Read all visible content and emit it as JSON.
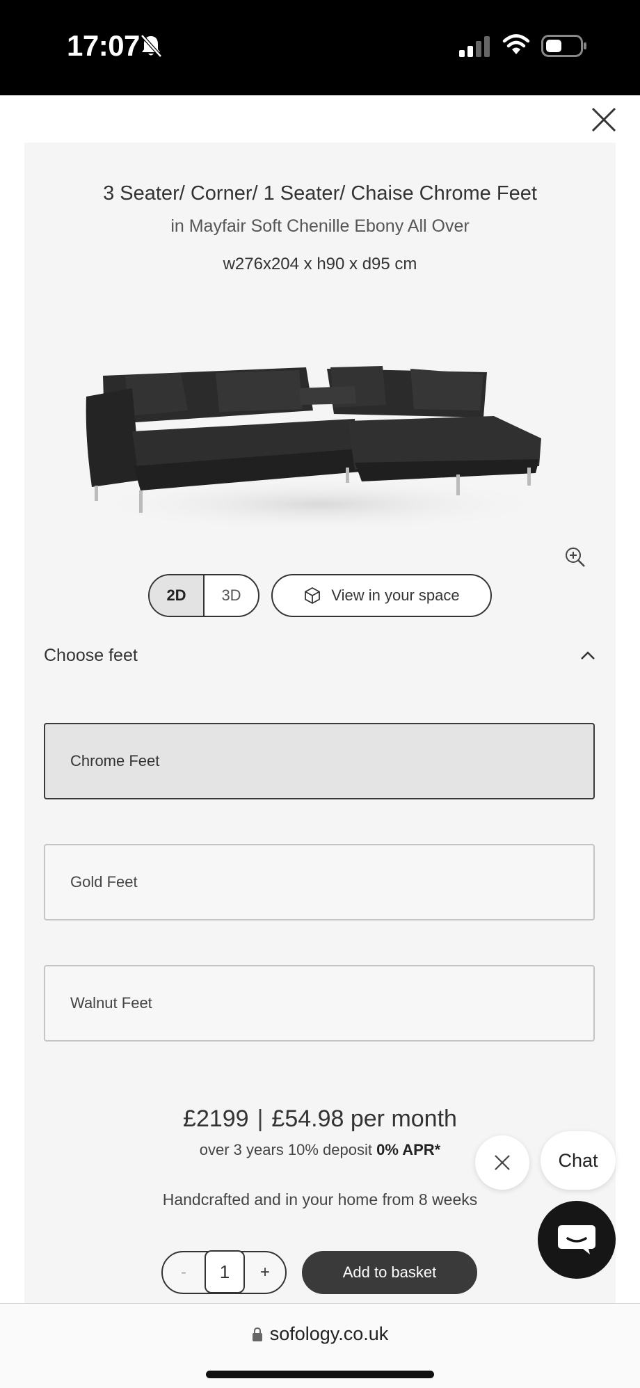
{
  "status_bar": {
    "time": "17:07"
  },
  "product": {
    "title": "3 Seater/ Corner/ 1 Seater/ Chaise Chrome Feet",
    "fabric": "in Mayfair Soft Chenille Ebony All Over",
    "dimensions": "w276x204 x h90 x d95 cm"
  },
  "view_toggle": {
    "option_2d": "2D",
    "option_3d": "3D",
    "selected": "2D"
  },
  "view_in_space_label": "View in your space",
  "feet_section": {
    "title": "Choose feet",
    "options": [
      {
        "label": "Chrome Feet",
        "selected": true
      },
      {
        "label": "Gold Feet",
        "selected": false
      },
      {
        "label": "Walnut Feet",
        "selected": false
      }
    ]
  },
  "pricing": {
    "price": "£2199",
    "separator": "|",
    "monthly": "£54.98 per month",
    "finance_text": "over 3 years 10% deposit",
    "apr": "0% APR*",
    "delivery": "Handcrafted and in your home from 8 weeks"
  },
  "quantity": {
    "minus": "-",
    "value": "1",
    "plus": "+"
  },
  "add_to_basket_label": "Add to basket",
  "chat": {
    "label": "Chat"
  },
  "browser": {
    "url": "sofology.co.uk"
  },
  "colors": {
    "panel_bg": "#f5f5f5",
    "button_dark": "#3a3a3a",
    "selected_option_bg": "#e4e4e4"
  }
}
